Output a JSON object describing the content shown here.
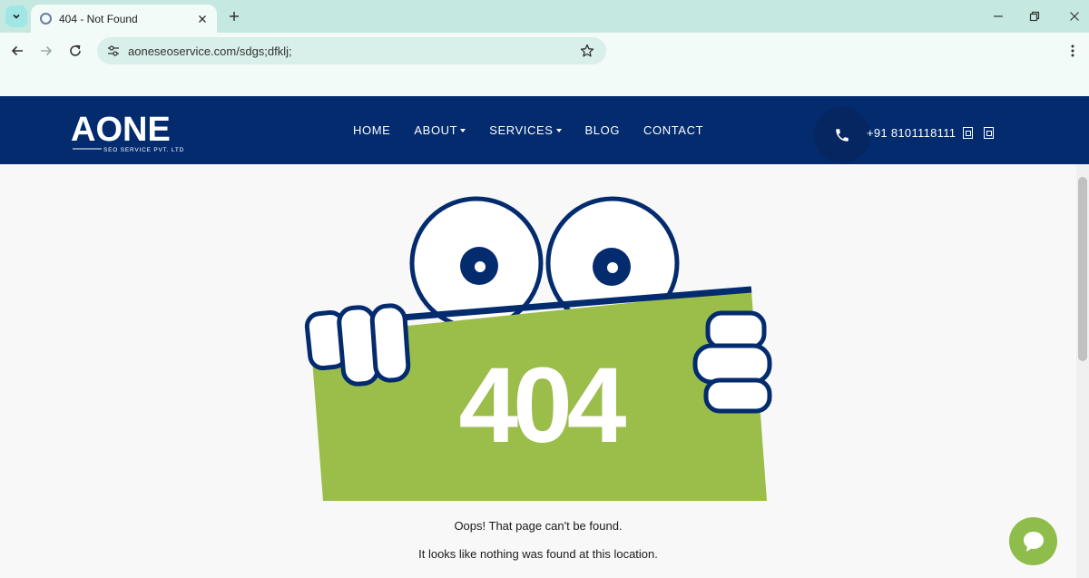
{
  "browser": {
    "tab_title": "404 - Not Found",
    "url": "aoneseoservice.com/sdgs;dfklj;"
  },
  "header": {
    "logo_main": "AONE",
    "logo_sub": "SEO SERVICE PVT. LTD",
    "nav": [
      {
        "label": "HOME"
      },
      {
        "label": "ABOUT"
      },
      {
        "label": "SERVICES"
      },
      {
        "label": "BLOG"
      },
      {
        "label": "CONTACT"
      }
    ],
    "phone": "+91 8101118111"
  },
  "content": {
    "error_code": "404",
    "message_1": "Oops! That page can't be found.",
    "message_2": "It looks like nothing was found at this location."
  },
  "colors": {
    "brand_navy": "#032b6e",
    "sign_green": "#9bbd4a",
    "chat_green": "#8fbd4b"
  }
}
